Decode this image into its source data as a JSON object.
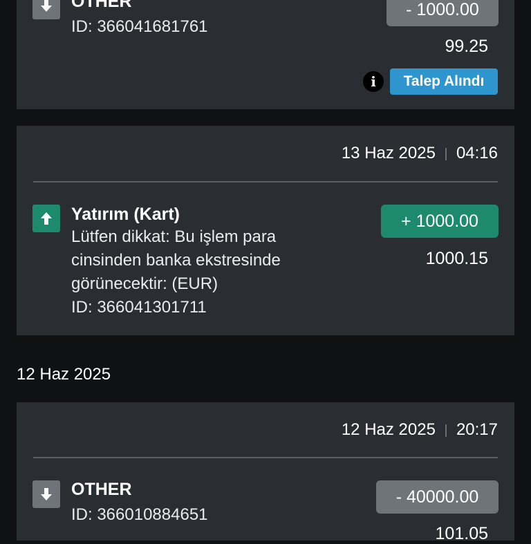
{
  "transactions": [
    {
      "title": "OTHER",
      "id_line": "ID: 366041681761",
      "amount": "- 1000.00",
      "balance": "99.25",
      "status": "Talep Alındı",
      "icon": "arrow-down-icon"
    },
    {
      "date": "13 Haz 2025",
      "time": "04:16",
      "title": "Yatırım (Kart)",
      "note_lines": [
        "Lütfen dikkat: Bu işlem para",
        "cinsinden banka ekstresinde",
        "görünecektir: (EUR)"
      ],
      "id_line": "ID: 366041301711",
      "amount": "+ 1000.00",
      "balance": "1000.15",
      "icon": "arrow-up-icon"
    },
    {
      "date": "12 Haz 2025",
      "time": "20:17",
      "title": "OTHER",
      "id_line": "ID: 366010884651",
      "amount": "- 40000.00",
      "balance": "101.05",
      "icon": "arrow-down-icon"
    }
  ],
  "groups": [
    {
      "date_label": "12 Haz 2025"
    }
  ],
  "colors": {
    "background": "#0f1113",
    "card": "#2a2d31",
    "credit": "#1e8a6d",
    "debit": "#6f7479",
    "status_badge": "#2f95cf"
  }
}
